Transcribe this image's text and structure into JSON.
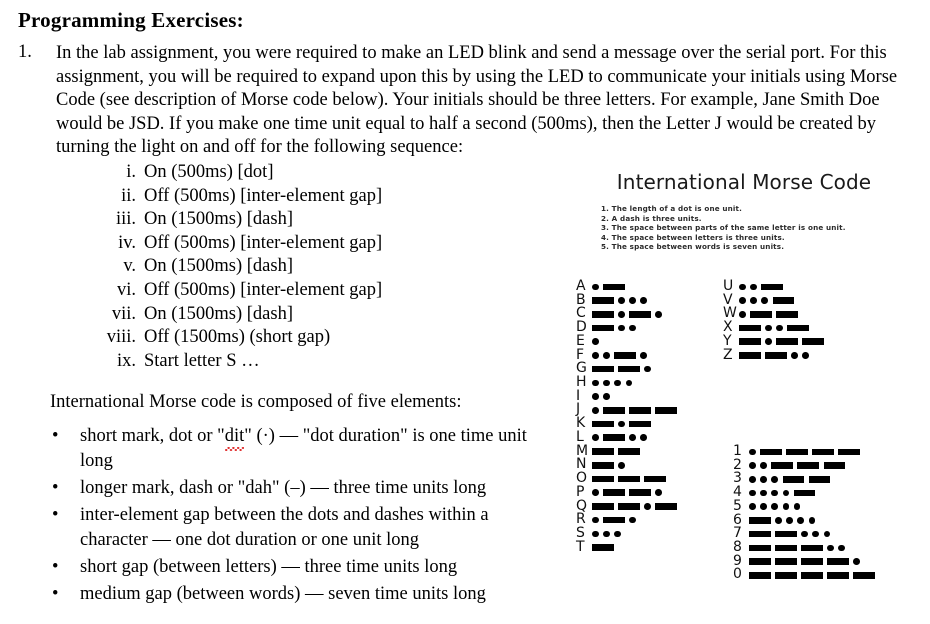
{
  "document": {
    "heading": "Programming Exercises:",
    "exercise": {
      "number": "1.",
      "paragraph": "In the lab assignment, you were required to make an LED blink and send a message over the serial port. For this assignment, you will be required to expand upon this by using the LED to communicate your initials using Morse Code (see description of Morse code below). Your initials should be three letters. For example, Jane Smith Doe would be JSD. If you make one time unit equal to half a second (500ms), then the Letter J would be created by turning the light on and off for the following sequence:"
    },
    "roman_list": [
      {
        "marker": "i.",
        "text": "On (500ms) [dot]"
      },
      {
        "marker": "ii.",
        "text": "Off (500ms) [inter-element gap]"
      },
      {
        "marker": "iii.",
        "text": "On (1500ms) [dash]"
      },
      {
        "marker": "iv.",
        "text": "Off (500ms) [inter-element gap]"
      },
      {
        "marker": "v.",
        "text": "On (1500ms) [dash]"
      },
      {
        "marker": "vi.",
        "text": "Off (500ms) [inter-element gap]"
      },
      {
        "marker": "vii.",
        "text": "On (1500ms) [dash]"
      },
      {
        "marker": "viii.",
        "text": "Off (1500ms) (short gap)"
      },
      {
        "marker": "ix.",
        "text": "Start letter S …"
      }
    ],
    "elements_intro": "International Morse code is composed of five elements:",
    "bullet_marker": "•",
    "bullets": [
      {
        "pre": "short mark, dot or \"",
        "misspelled": "dit",
        "post": "\" (·) — \"dot duration\" is one time unit long"
      },
      {
        "pre": "longer mark, dash or \"dah\" (–) — three time units long",
        "misspelled": "",
        "post": ""
      },
      {
        "pre": "inter-element gap between the dots and dashes within a character — one dot duration or one unit long",
        "misspelled": "",
        "post": ""
      },
      {
        "pre": "short gap (between letters) — three time units long",
        "misspelled": "",
        "post": ""
      },
      {
        "pre": "medium gap (between words) — seven time units long",
        "misspelled": "",
        "post": ""
      }
    ]
  },
  "morse_chart": {
    "title": "International Morse Code",
    "rules": [
      "1. The length of a dot is one unit.",
      "2. A dash is three units.",
      "3. The space between parts of the same letter is one unit.",
      "4. The space between letters is three units.",
      "5. The space between words is seven units."
    ],
    "letters_left": [
      {
        "label": "A",
        "code": ".-"
      },
      {
        "label": "B",
        "code": "-..."
      },
      {
        "label": "C",
        "code": "-.-."
      },
      {
        "label": "D",
        "code": "-.."
      },
      {
        "label": "E",
        "code": "."
      },
      {
        "label": "F",
        "code": "..-."
      },
      {
        "label": "G",
        "code": "--."
      },
      {
        "label": "H",
        "code": "...."
      },
      {
        "label": "I",
        "code": ".."
      },
      {
        "label": "J",
        "code": ".---"
      },
      {
        "label": "K",
        "code": "-.-"
      },
      {
        "label": "L",
        "code": ".-.."
      },
      {
        "label": "M",
        "code": "--"
      },
      {
        "label": "N",
        "code": "-."
      },
      {
        "label": "O",
        "code": "---"
      },
      {
        "label": "P",
        "code": ".--."
      },
      {
        "label": "Q",
        "code": "--.-"
      },
      {
        "label": "R",
        "code": ".-."
      },
      {
        "label": "S",
        "code": "..."
      },
      {
        "label": "T",
        "code": "-"
      }
    ],
    "letters_right": [
      {
        "label": "U",
        "code": "..-"
      },
      {
        "label": "V",
        "code": "...-"
      },
      {
        "label": "W",
        "code": ".--"
      },
      {
        "label": "X",
        "code": "-..-"
      },
      {
        "label": "Y",
        "code": "-.--"
      },
      {
        "label": "Z",
        "code": "--.."
      }
    ],
    "digits": [
      {
        "label": "1",
        "code": ".----"
      },
      {
        "label": "2",
        "code": "..---"
      },
      {
        "label": "3",
        "code": "...--"
      },
      {
        "label": "4",
        "code": "....-"
      },
      {
        "label": "5",
        "code": "....."
      },
      {
        "label": "6",
        "code": "-...."
      },
      {
        "label": "7",
        "code": "--..."
      },
      {
        "label": "8",
        "code": "---.."
      },
      {
        "label": "9",
        "code": "----."
      },
      {
        "label": "0",
        "code": "-----"
      }
    ]
  },
  "colors": {
    "ink": "#000000",
    "spellcheck_underline": "#e03030",
    "page_background": "#ffffff"
  }
}
